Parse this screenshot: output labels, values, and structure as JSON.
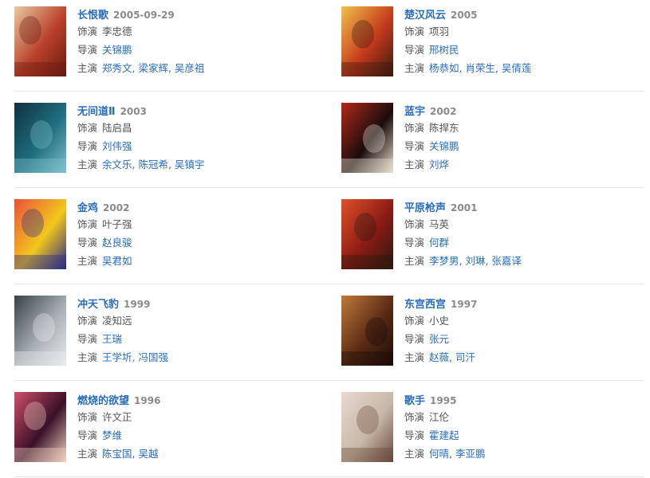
{
  "films": [
    {
      "title": "长恨歌",
      "year": "2005-09-29",
      "actor_label": "饰演",
      "actor": "李忠德",
      "director_label": "导演",
      "director": "关锦鹏",
      "cast_label": "主演",
      "cast": "郑秀文, 梁家辉, 吴彦祖",
      "poster_colors": [
        "#b8402a",
        "#e8c9a0",
        "#6a1a10"
      ]
    },
    {
      "title": "楚汉风云",
      "year": "2005",
      "actor_label": "饰演",
      "actor": "项羽",
      "director_label": "导演",
      "director": "邢树民",
      "cast_label": "主演",
      "cast": "杨恭如, 肖荣生, 吴倩莲",
      "poster_colors": [
        "#c43a1c",
        "#f2c14a",
        "#3a1a10"
      ]
    },
    {
      "title": "无间道Ⅱ",
      "year": "2003",
      "actor_label": "饰演",
      "actor": "陆启昌",
      "director_label": "导演",
      "director": "刘伟强",
      "cast_label": "主演",
      "cast": "余文乐, 陈冠希, 吴镇宇",
      "poster_colors": [
        "#1f6f80",
        "#0f3040",
        "#7fc0cc"
      ]
    },
    {
      "title": "蓝宇",
      "year": "2002",
      "actor_label": "饰演",
      "actor": "陈捍东",
      "director_label": "导演",
      "director": "关锦鹏",
      "cast_label": "主演",
      "cast": "刘烨",
      "poster_colors": [
        "#1a0c0c",
        "#b22a1a",
        "#e8e0d0"
      ]
    },
    {
      "title": "金鸡",
      "year": "2002",
      "actor_label": "饰演",
      "actor": "叶子强",
      "director_label": "导演",
      "director": "赵良骏",
      "cast_label": "主演",
      "cast": "吴君如",
      "poster_colors": [
        "#f2c81c",
        "#e8503a",
        "#2a2a8a"
      ]
    },
    {
      "title": "平原枪声",
      "year": "2001",
      "actor_label": "饰演",
      "actor": "马英",
      "director_label": "导演",
      "director": "何群",
      "cast_label": "主演",
      "cast": "李梦男, 刘琳, 张嘉译",
      "poster_colors": [
        "#8a1a14",
        "#e0502a",
        "#2a1a10"
      ]
    },
    {
      "title": "冲天飞豹",
      "year": "1999",
      "actor_label": "饰演",
      "actor": "凌知远",
      "director_label": "导演",
      "director": "王瑞",
      "cast_label": "主演",
      "cast": "王学圻, 冯国强",
      "poster_colors": [
        "#a8b0b4",
        "#3a4048",
        "#e8ecee"
      ]
    },
    {
      "title": "东宫西宫",
      "year": "1997",
      "actor_label": "饰演",
      "actor": "小史",
      "director_label": "导演",
      "director": "张元",
      "cast_label": "主演",
      "cast": "赵薇, 司汗",
      "poster_colors": [
        "#5a2a14",
        "#c07a3a",
        "#1a0c08"
      ]
    },
    {
      "title": "燃烧的欲望",
      "year": "1996",
      "actor_label": "饰演",
      "actor": "许文正",
      "director_label": "导演",
      "director": "梦维",
      "cast_label": "主演",
      "cast": "陈宝国, 吴越",
      "poster_colors": [
        "#3a1028",
        "#d0506a",
        "#f0d0c0"
      ]
    },
    {
      "title": "歌手",
      "year": "1995",
      "actor_label": "饰演",
      "actor": "江伦",
      "director_label": "导演",
      "director": "霍建起",
      "cast_label": "主演",
      "cast": "何晴, 李亚鹏",
      "poster_colors": [
        "#c8b8a8",
        "#e8d8d0",
        "#6a4a3a"
      ]
    }
  ]
}
